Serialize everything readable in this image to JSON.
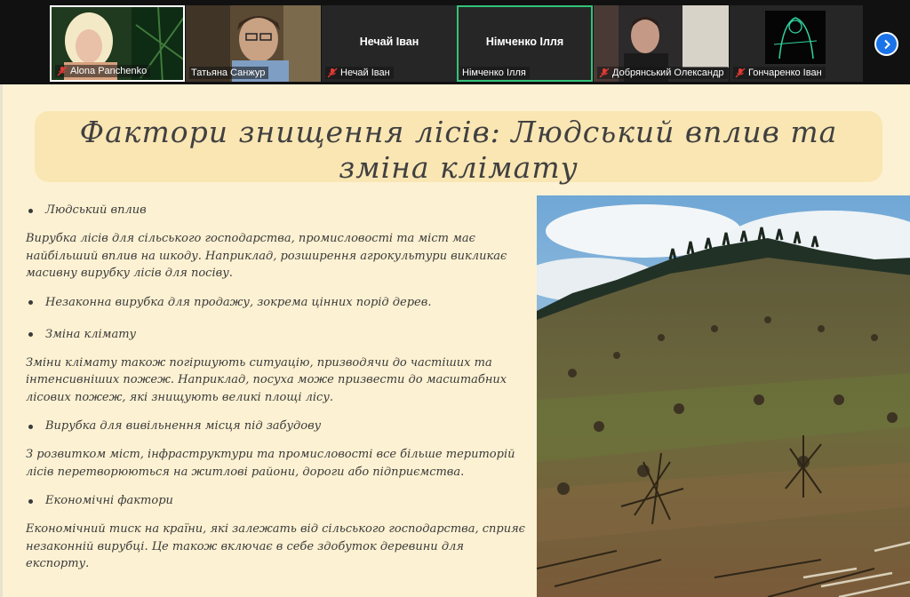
{
  "participants": [
    {
      "name": "Alona Panchenko",
      "muted": true,
      "video": true,
      "state": "speaking"
    },
    {
      "name": "Татьяна Санжур",
      "muted": false,
      "video": true,
      "state": ""
    },
    {
      "name": "Нечай Іван",
      "center_name": "Нечай Іван",
      "muted": true,
      "video": false,
      "state": ""
    },
    {
      "name": "Німченко Ілля",
      "center_name": "Німченко Ілля",
      "muted": false,
      "video": false,
      "state": "active"
    },
    {
      "name": "Добрянський Олександр",
      "muted": true,
      "video": true,
      "state": ""
    },
    {
      "name": "Гончаренко Іван",
      "muted": true,
      "video": true,
      "state": ""
    }
  ],
  "slide": {
    "title_line1": "Фактори знищення лісів: Людський вплив та",
    "title_line2": "зміна клімату",
    "bullets": [
      {
        "label": "Людський вплив",
        "text": "Вирубка лісів для сільського господарства, промисловості та міст має найбільший вплив на шкоду. Наприклад, розширення агрокультури викликає масивну вирубку лісів для посіву."
      },
      {
        "label": "Незаконна вирубка для продажу, зокрема цінних порід дерев.",
        "text": ""
      },
      {
        "label": "Зміна клімату",
        "text": "Зміни клімату також погіршують ситуацію, призводячи до частіших та інтенсивніших пожеж. Наприклад, посуха може призвести до масштабних лісових пожеж, які знищують великі площі лісу."
      },
      {
        "label": "Вирубка для вивільнення місця під забудову",
        "text": "З розвитком міст, інфраструктури та промисловості все більше територій лісів перетворюються на житлові райони, дороги або підприємства."
      },
      {
        "label": "Економічні фактори",
        "text": "Економічний тиск на країни, які залежать від сільського господарства, сприяє незаконній вирубці. Це також включає в себе здобуток деревини для експорту."
      }
    ]
  },
  "icons": {
    "mic_muted": "mic-muted-icon",
    "next": "chevron-right-icon"
  },
  "colors": {
    "slide_bg": "#fcf1d2",
    "title_box": "#fae6b3",
    "active_border": "#34c27a",
    "muted_icon": "#e53935",
    "next_button": "#1a73e8"
  }
}
